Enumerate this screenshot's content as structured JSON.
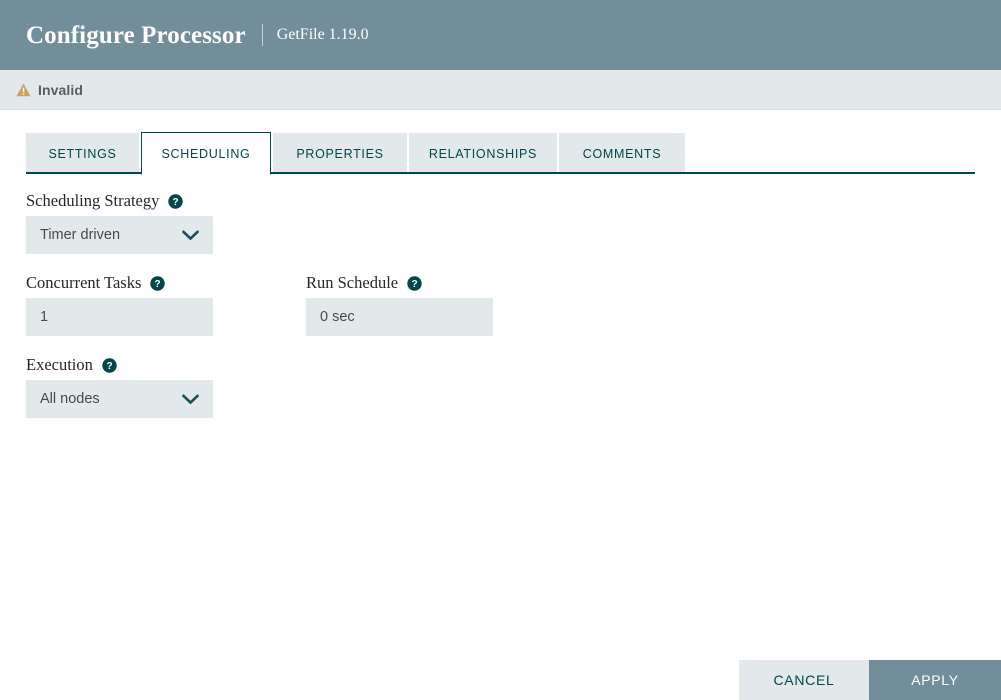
{
  "header": {
    "title": "Configure Processor",
    "subtitle": "GetFile 1.19.0",
    "background_color": "#728e9b"
  },
  "status": {
    "icon": "warning-triangle-icon",
    "text": "Invalid",
    "icon_color": "#cf9f5d",
    "background_color": "#e3e8eb"
  },
  "tabs": [
    {
      "label": "SETTINGS",
      "active": false
    },
    {
      "label": "SCHEDULING",
      "active": true
    },
    {
      "label": "PROPERTIES",
      "active": false
    },
    {
      "label": "RELATIONSHIPS",
      "active": false
    },
    {
      "label": "COMMENTS",
      "active": false
    }
  ],
  "accent_color": "#004849",
  "fields": {
    "scheduling_strategy": {
      "label": "Scheduling Strategy",
      "value": "Timer driven",
      "type": "dropdown",
      "help": "?"
    },
    "concurrent_tasks": {
      "label": "Concurrent Tasks",
      "value": "1",
      "type": "input",
      "help": "?"
    },
    "run_schedule": {
      "label": "Run Schedule",
      "value": "0 sec",
      "type": "input",
      "help": "?"
    },
    "execution": {
      "label": "Execution",
      "value": "All nodes",
      "type": "dropdown",
      "help": "?"
    }
  },
  "footer": {
    "cancel_label": "CANCEL",
    "apply_label": "APPLY",
    "apply_color": "#728e9b",
    "cancel_color": "#e3e8eb"
  }
}
